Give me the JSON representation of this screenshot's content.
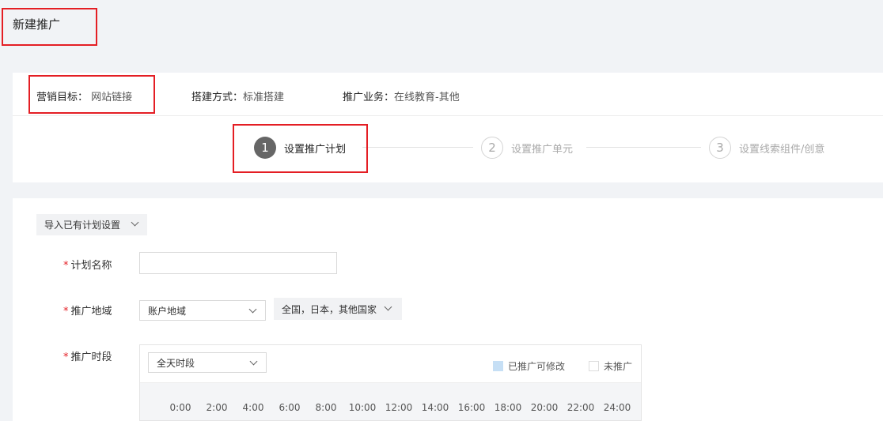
{
  "page": {
    "title": "新建推广"
  },
  "summary": {
    "goal_label": "营销目标：",
    "goal_value": "网站链接",
    "build_label": "搭建方式：",
    "build_value": "标准搭建",
    "business_label": "推广业务：",
    "business_value": "在线教育-其他"
  },
  "steps": [
    {
      "num": "1",
      "label": "设置推广计划",
      "state": "active"
    },
    {
      "num": "2",
      "label": "设置推广单元",
      "state": "inactive"
    },
    {
      "num": "3",
      "label": "设置线索组件/创意",
      "state": "inactive"
    }
  ],
  "form": {
    "import_button": "导入已有计划设置",
    "required_mark": "*",
    "plan_name_label": "计划名称",
    "plan_name_value": "",
    "region_label": "推广地域",
    "region_select": "账户地域",
    "region_value": "全国，日本，其他国家",
    "schedule_label": "推广时段",
    "schedule_select": "全天时段",
    "legend_on": "已推广可修改",
    "legend_off": "未推广",
    "hours": [
      "0:00",
      "2:00",
      "4:00",
      "6:00",
      "8:00",
      "10:00",
      "12:00",
      "14:00",
      "16:00",
      "18:00",
      "20:00",
      "22:00",
      "24:00"
    ]
  },
  "colors": {
    "highlight": "#e41e24",
    "active_step": "#666666",
    "legend_on": "#c6dff5"
  },
  "icons": {
    "dropdown": "chevron-down-icon"
  }
}
